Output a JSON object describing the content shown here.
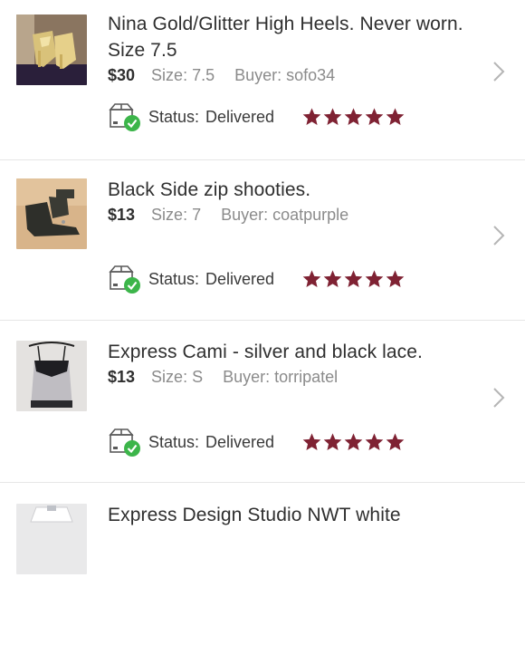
{
  "colors": {
    "star": "#7f2233",
    "check": "#3cb54a",
    "divider": "#e6e6e6",
    "muted": "#8b8b8b"
  },
  "icons": {
    "status": "package-delivered-icon",
    "rating": "star-icon",
    "nav": "chevron-right-icon"
  },
  "items": [
    {
      "title": "Nina Gold/Glitter High Heels. Never worn. Size 7.5",
      "price": "$30",
      "size": "Size: 7.5",
      "buyer": "Buyer: sofo34",
      "status_label": "Status:",
      "status_value": "Delivered",
      "rating": 5
    },
    {
      "title": "Black Side zip shooties.",
      "price": "$13",
      "size": "Size: 7",
      "buyer": "Buyer: coatpurple",
      "status_label": "Status:",
      "status_value": "Delivered",
      "rating": 5
    },
    {
      "title": "Express Cami - silver and black lace.",
      "price": "$13",
      "size": "Size: S",
      "buyer": "Buyer: torripatel",
      "status_label": "Status:",
      "status_value": "Delivered",
      "rating": 5
    },
    {
      "title": "Express Design Studio NWT white"
    }
  ]
}
